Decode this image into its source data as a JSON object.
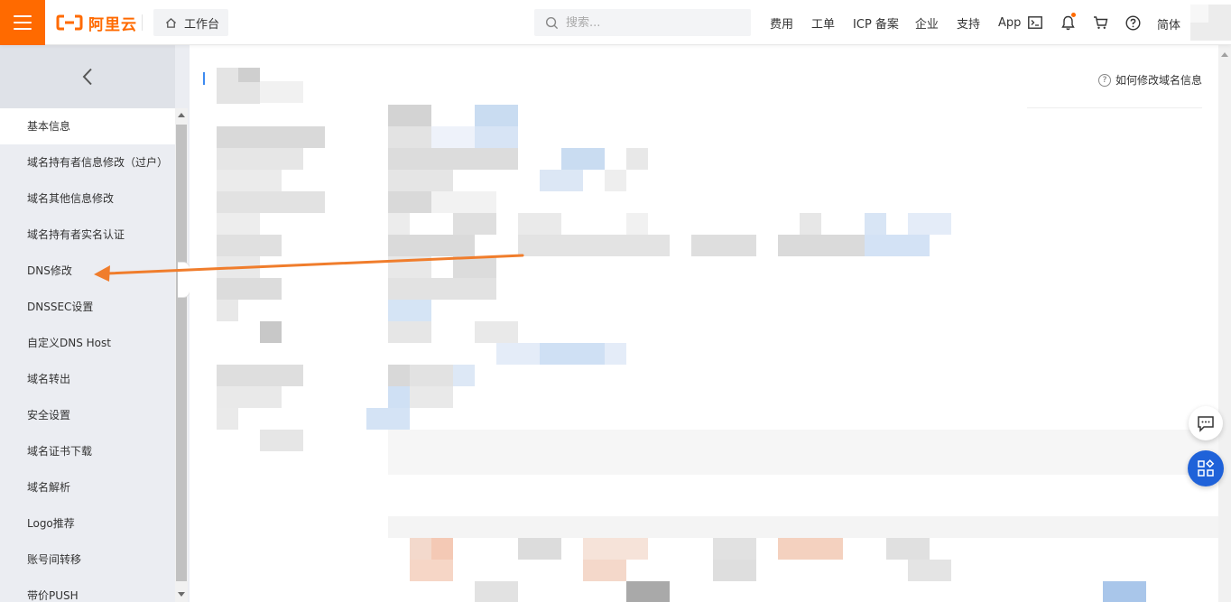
{
  "header": {
    "logo_text": "阿里云",
    "workbench_label": "工作台",
    "search_placeholder": "搜索...",
    "nav_items": [
      "费用",
      "工单",
      "ICP 备案",
      "企业",
      "支持",
      "App"
    ],
    "language": "简体"
  },
  "sidebar": {
    "items": [
      {
        "label": "基本信息",
        "active": true
      },
      {
        "label": "域名持有者信息修改（过户）"
      },
      {
        "label": "域名其他信息修改"
      },
      {
        "label": "域名持有者实名认证"
      },
      {
        "label": "DNS修改"
      },
      {
        "label": "DNSSEC设置"
      },
      {
        "label": "自定义DNS Host"
      },
      {
        "label": "域名转出"
      },
      {
        "label": "安全设置"
      },
      {
        "label": "域名证书下载"
      },
      {
        "label": "域名解析"
      },
      {
        "label": "Logo推荐"
      },
      {
        "label": "账号间转移"
      },
      {
        "label": "带价PUSH"
      }
    ]
  },
  "main": {
    "help_link": "如何修改域名信息"
  },
  "annotation": {
    "color": "#f07d2c",
    "points_to": "DNS修改"
  },
  "colors": {
    "brand": "#ff6a00",
    "sidebar_bg": "#ebedf2",
    "float_apps_bg": "#1f62d9"
  },
  "icons": [
    "menu-icon",
    "home-icon",
    "search-icon",
    "terminal-icon",
    "bell-icon",
    "cart-icon",
    "help-icon",
    "chevron-left-icon",
    "chat-icon",
    "apps-icon"
  ]
}
